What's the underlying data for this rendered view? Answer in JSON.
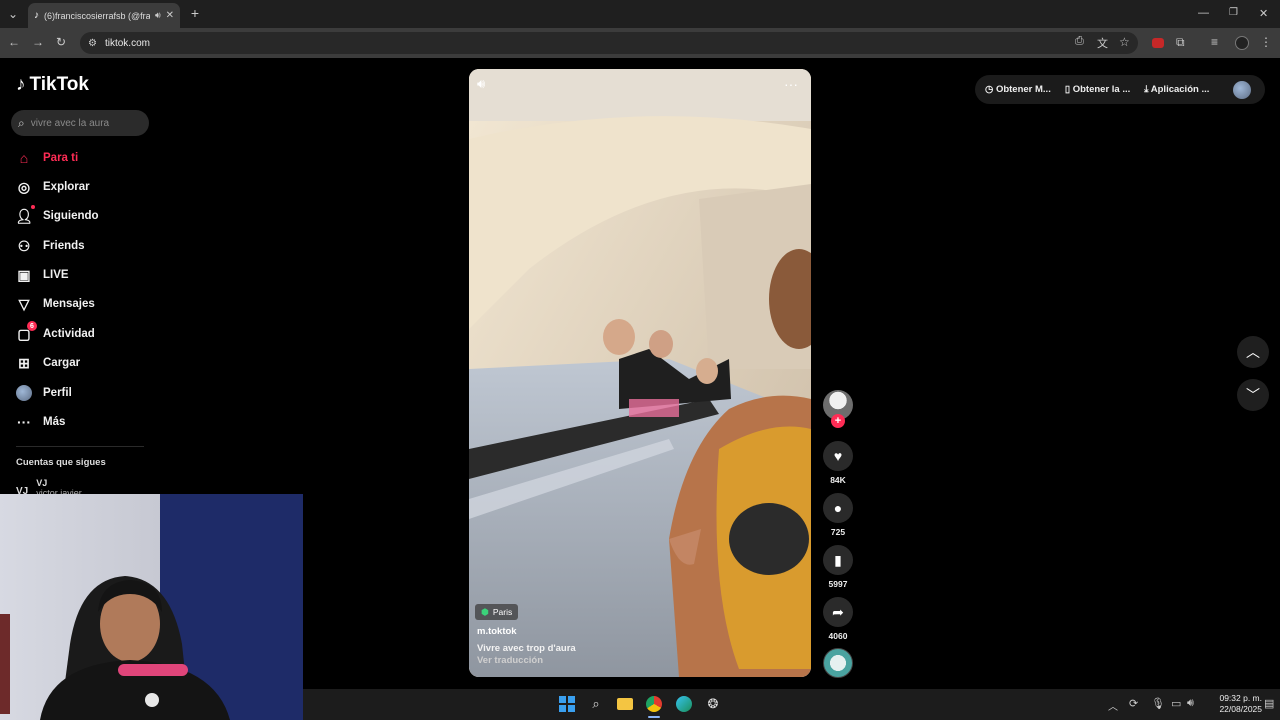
{
  "browser": {
    "tab_title": "(6)franciscosierrafsb (@fran",
    "url": "tiktok.com",
    "new_tab_label": "+"
  },
  "sidebar": {
    "logo": "TikTok",
    "search_placeholder": "vivre avec la aura",
    "items": [
      {
        "label": "Para ti",
        "icon": "home-icon",
        "active": true
      },
      {
        "label": "Explorar",
        "icon": "compass-icon"
      },
      {
        "label": "Siguiendo",
        "icon": "following-icon"
      },
      {
        "label": "Friends",
        "icon": "friends-icon"
      },
      {
        "label": "LIVE",
        "icon": "live-icon"
      },
      {
        "label": "Mensajes",
        "icon": "messages-icon"
      },
      {
        "label": "Actividad",
        "icon": "activity-icon",
        "badge": "6"
      },
      {
        "label": "Cargar",
        "icon": "upload-icon"
      },
      {
        "label": "Perfil",
        "icon": "avatar"
      },
      {
        "label": "Más",
        "icon": "more-icon"
      }
    ],
    "following_title": "Cuentas que sigues",
    "following_account_initials": "VJ",
    "following_account_name": "VJ",
    "following_account_handle": "victor javier"
  },
  "video": {
    "location": "Paris",
    "author": "m.toktok",
    "caption": "Vivre avec trop d'aura",
    "translate": "Ver traducción"
  },
  "actions": {
    "likes": "84K",
    "comments": "725",
    "saves": "5997",
    "shares": "4060"
  },
  "top_links": {
    "coins": "Obtener M...",
    "app": "Obtener la ...",
    "desktop": "Aplicación ..."
  },
  "taskbar": {
    "time": "09:32 p. m.",
    "date": "22/08/2025"
  },
  "colors": {
    "accent": "#fe2c55",
    "background": "#000000"
  }
}
